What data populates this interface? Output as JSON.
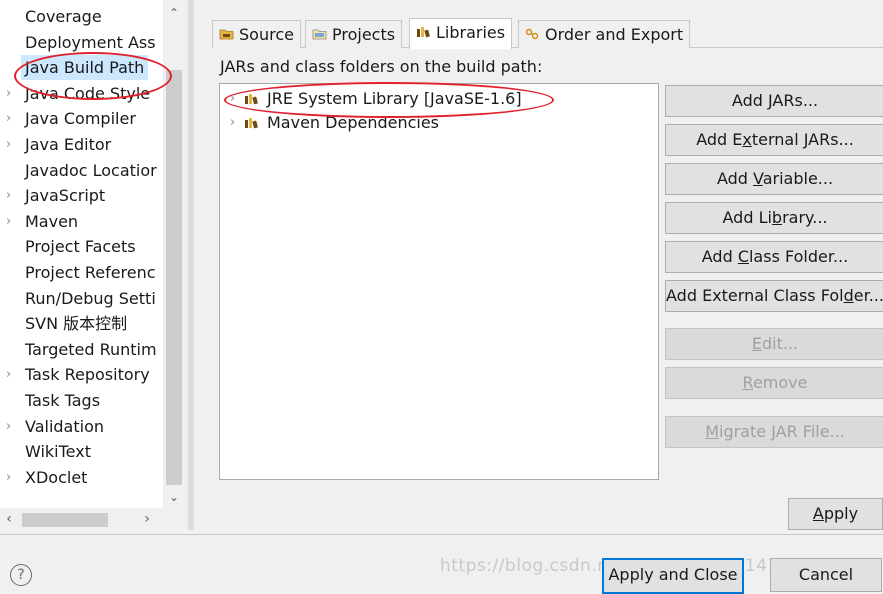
{
  "sidebar": {
    "items": [
      {
        "label": "Coverage",
        "expandable": false
      },
      {
        "label": "Deployment Ass",
        "expandable": false
      },
      {
        "label": "Java Build Path",
        "expandable": false,
        "selected": true
      },
      {
        "label": "Java Code Style",
        "expandable": true
      },
      {
        "label": "Java Compiler",
        "expandable": true
      },
      {
        "label": "Java Editor",
        "expandable": true
      },
      {
        "label": "Javadoc Locatior",
        "expandable": false
      },
      {
        "label": "JavaScript",
        "expandable": true
      },
      {
        "label": "Maven",
        "expandable": true
      },
      {
        "label": "Project Facets",
        "expandable": false
      },
      {
        "label": "Project Referenc",
        "expandable": false
      },
      {
        "label": "Run/Debug Setti",
        "expandable": false
      },
      {
        "label": "SVN 版本控制",
        "expandable": false
      },
      {
        "label": "Targeted Runtim",
        "expandable": false
      },
      {
        "label": "Task Repository",
        "expandable": true
      },
      {
        "label": "Task Tags",
        "expandable": false
      },
      {
        "label": "Validation",
        "expandable": true
      },
      {
        "label": "WikiText",
        "expandable": false
      },
      {
        "label": "XDoclet",
        "expandable": true
      }
    ]
  },
  "tabs": [
    {
      "label": "Source",
      "icon": "source-folder-icon"
    },
    {
      "label": "Projects",
      "icon": "projects-icon"
    },
    {
      "label": "Libraries",
      "icon": "library-icon",
      "active": true
    },
    {
      "label": "Order and Export",
      "icon": "order-export-icon"
    }
  ],
  "main": {
    "build_path_label": "JARs and class folders on the build path:",
    "libraries": [
      {
        "label": "JRE System Library [JavaSE-1.6]"
      },
      {
        "label": "Maven Dependencies"
      }
    ]
  },
  "buttons": {
    "add_jars": {
      "pre": "Add ",
      "key": "J",
      "post": "ARs..."
    },
    "add_external_jars": {
      "pre": "Add E",
      "key": "x",
      "post": "ternal JARs..."
    },
    "add_variable": {
      "pre": "Add ",
      "key": "V",
      "post": "ariable..."
    },
    "add_library": {
      "pre": "Add Li",
      "key": "b",
      "post": "rary..."
    },
    "add_class_folder": {
      "pre": "Add ",
      "key": "C",
      "post": "lass Folder..."
    },
    "add_external_class_folder": {
      "pre": "Add External Class Fol",
      "key": "d",
      "post": "er..."
    },
    "edit": {
      "pre": "",
      "key": "E",
      "post": "dit..."
    },
    "remove": {
      "pre": "",
      "key": "R",
      "post": "emove"
    },
    "migrate": {
      "pre": "",
      "key": "M",
      "post": "igrate JAR File..."
    },
    "apply": {
      "pre": "",
      "key": "A",
      "post": "pply"
    },
    "apply_close": "Apply and Close",
    "cancel": "Cancel"
  },
  "watermark": "https://blog.csdn.net/weixin_43751410",
  "colors": {
    "annotation_red": "#e0212c",
    "selection": "#cce8ff",
    "default_button_border": "#0078d7"
  }
}
